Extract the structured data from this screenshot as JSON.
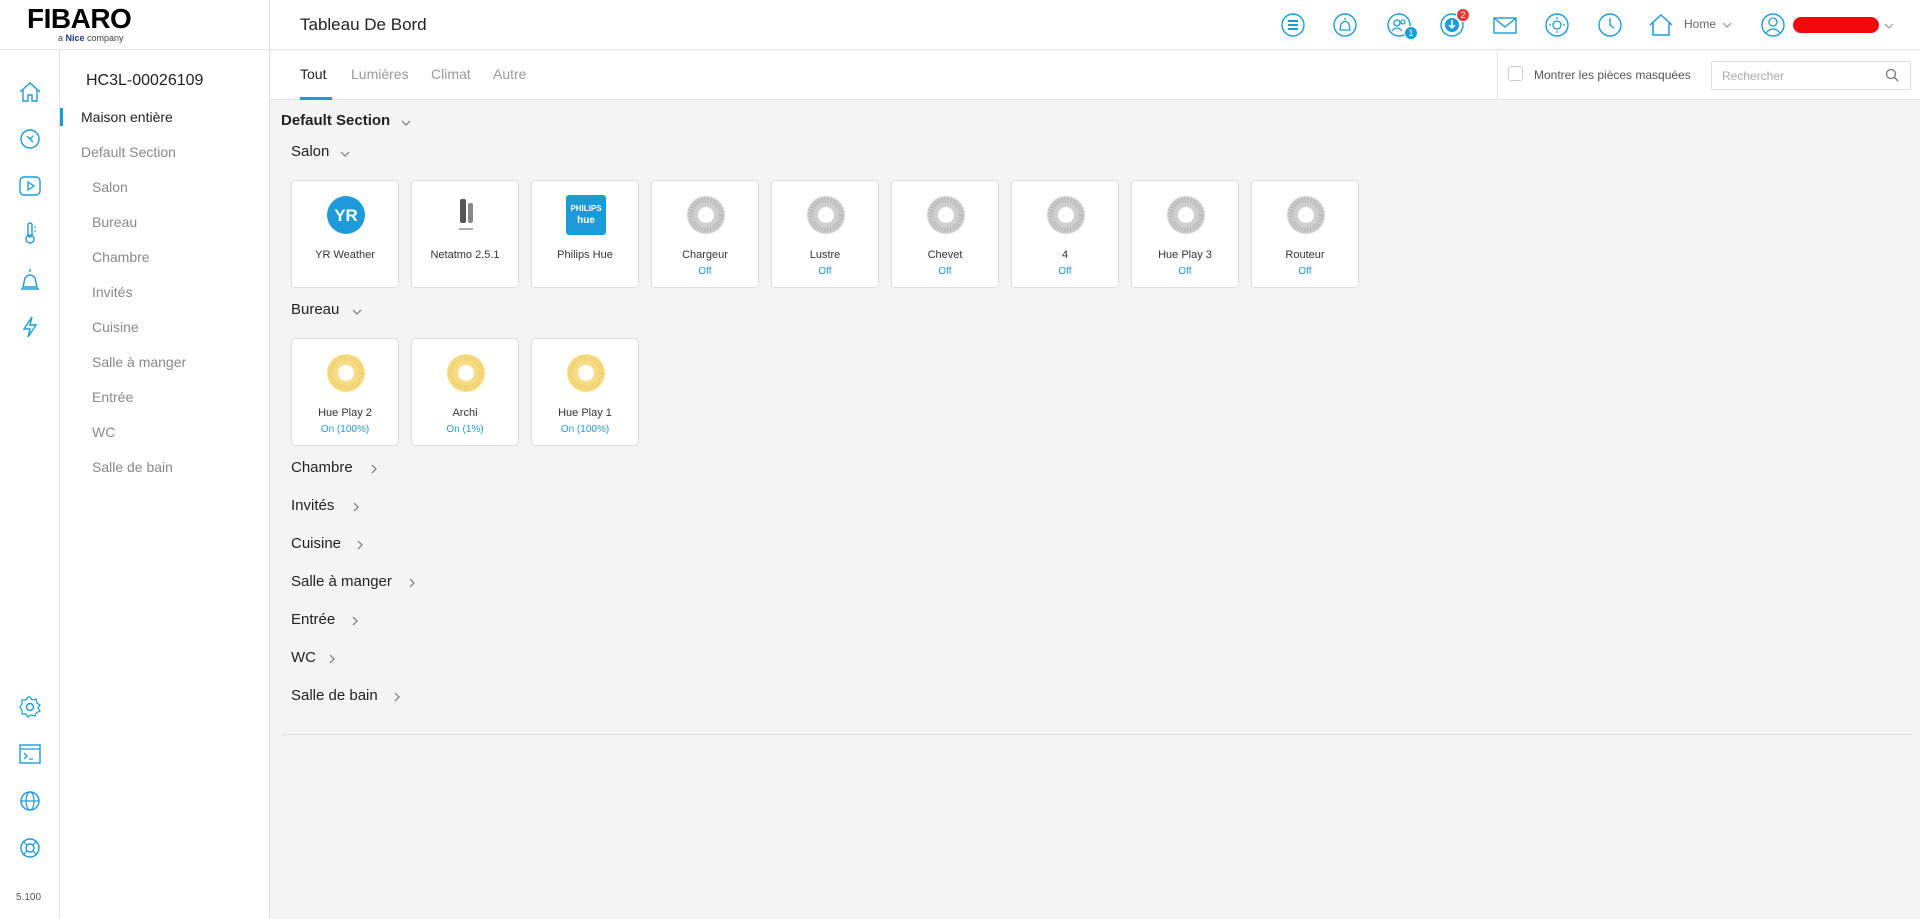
{
  "brand": {
    "logo": "FIBARO",
    "sub_prefix": "a ",
    "sub_brand": "Nice",
    "sub_suffix": " company"
  },
  "header": {
    "title": "Tableau De Bord",
    "badges": {
      "users": "1",
      "updates": "2"
    },
    "home_label": "Home"
  },
  "rail": {
    "version": "5.100"
  },
  "rooms_panel": {
    "hc_name": "HC3L-00026109",
    "items": [
      {
        "label": "Maison entière"
      },
      {
        "label": "Default Section"
      },
      {
        "label": "Salon"
      },
      {
        "label": "Bureau"
      },
      {
        "label": "Chambre"
      },
      {
        "label": "Invités"
      },
      {
        "label": "Cuisine"
      },
      {
        "label": "Salle à manger"
      },
      {
        "label": "Entrée"
      },
      {
        "label": "WC"
      },
      {
        "label": "Salle de bain"
      }
    ]
  },
  "tabs": {
    "items": [
      {
        "label": "Tout"
      },
      {
        "label": "Lumières"
      },
      {
        "label": "Climat"
      },
      {
        "label": "Autre"
      }
    ],
    "show_hidden_label": "Montrer les pièces masquées",
    "search_placeholder": "Rechercher"
  },
  "content": {
    "section_title": "Default Section",
    "salon": {
      "title": "Salon",
      "devices": [
        {
          "name": "YR Weather",
          "status": "",
          "icon": "yr-logo"
        },
        {
          "name": "Netatmo 2.5.1",
          "status": "",
          "icon": "netatmo-station"
        },
        {
          "name": "Philips Hue",
          "status": "",
          "icon": "philips-hue-logo",
          "logo_line1": "PHILIPS",
          "logo_line2": "hue"
        },
        {
          "name": "Chargeur",
          "status": "Off",
          "icon": "light-off"
        },
        {
          "name": "Lustre",
          "status": "Off",
          "icon": "light-off"
        },
        {
          "name": "Chevet",
          "status": "Off",
          "icon": "light-off"
        },
        {
          "name": "4",
          "status": "Off",
          "icon": "light-off"
        },
        {
          "name": "Hue Play 3",
          "status": "Off",
          "icon": "light-off"
        },
        {
          "name": "Routeur",
          "status": "Off",
          "icon": "light-off"
        }
      ]
    },
    "bureau": {
      "title": "Bureau",
      "devices": [
        {
          "name": "Hue Play 2",
          "status": "On (100%)",
          "icon": "light-on"
        },
        {
          "name": "Archi",
          "status": "On (1%)",
          "icon": "light-on"
        },
        {
          "name": "Hue Play 1",
          "status": "On (100%)",
          "icon": "light-on"
        }
      ]
    },
    "collapsed_rooms": [
      {
        "title": "Chambre"
      },
      {
        "title": "Invités"
      },
      {
        "title": "Cuisine"
      },
      {
        "title": "Salle à manger"
      },
      {
        "title": "Entrée"
      },
      {
        "title": "WC"
      },
      {
        "title": "Salle de bain"
      }
    ]
  },
  "colors": {
    "accent": "#1d9bd8",
    "badge_red": "#e53935",
    "light_on": "#f7dc86",
    "light_off": "#cccccc"
  }
}
